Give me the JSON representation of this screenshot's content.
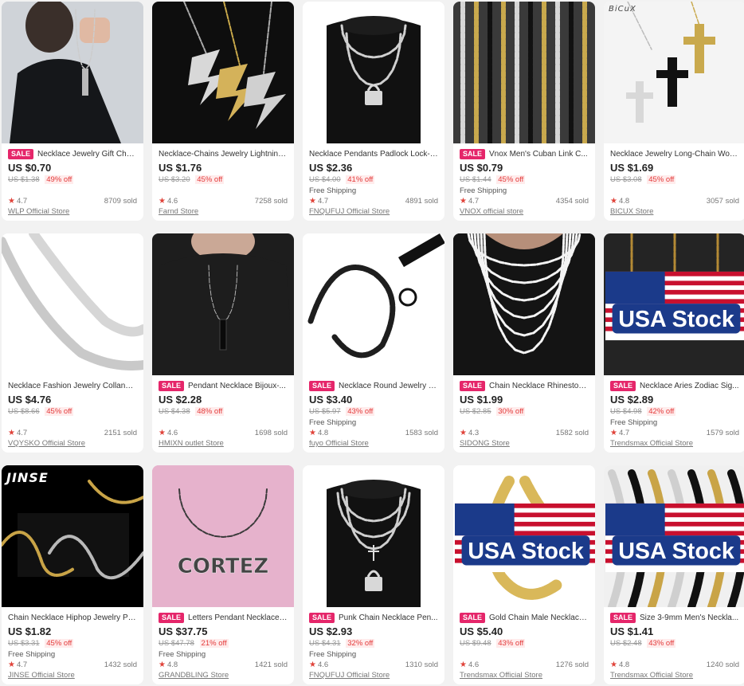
{
  "colors": {
    "sale_badge": "#e5266a",
    "discount": "#e33a3a",
    "star": "#e0433a",
    "background": "#f2f2f2"
  },
  "products": [
    {
      "sale": true,
      "title": "Necklace Jewelry Gift Chai...",
      "price": "US $0.70",
      "old_price": "US $1.38",
      "discount": "49% off",
      "shipping": "",
      "rating": "4.7",
      "sold": "8709 sold",
      "store": "WLP Official Store",
      "image": "man-with-pendant",
      "overlay": ""
    },
    {
      "sale": false,
      "title": "Necklace-Chains Jewelry Lightning ...",
      "price": "US $1.76",
      "old_price": "US $3.20",
      "discount": "45% off",
      "shipping": "",
      "rating": "4.6",
      "sold": "7258 sold",
      "store": "Farnd Store",
      "image": "lightning-pendants",
      "overlay": ""
    },
    {
      "sale": false,
      "title": "Necklace Pendants Padlock Lock-C...",
      "price": "US $2.36",
      "old_price": "US $4.00",
      "discount": "41% off",
      "shipping": "Free Shipping",
      "rating": "4.7",
      "sold": "4891 sold",
      "store": "FNQUFUJ Official Store",
      "image": "padlock-bust",
      "overlay": ""
    },
    {
      "sale": true,
      "title": "Vnox Men's Cuban Link C...",
      "price": "US $0.79",
      "old_price": "US $1.44",
      "discount": "45% off",
      "shipping": "Free Shipping",
      "rating": "4.7",
      "sold": "4354 sold",
      "store": "VNOX official store",
      "image": "cuban-chains",
      "overlay": ""
    },
    {
      "sale": false,
      "title": "Necklace Jewelry Long-Chain Wom...",
      "price": "US $1.69",
      "old_price": "US $3.08",
      "discount": "45% off",
      "shipping": "",
      "rating": "4.8",
      "sold": "3057 sold",
      "store": "BICUX Store",
      "image": "cross-pendants",
      "overlay": "BiCuX"
    },
    {
      "sale": false,
      "title": "Necklace Fashion Jewelry Collana ...",
      "price": "US $4.76",
      "old_price": "US $8.66",
      "discount": "45% off",
      "shipping": "",
      "rating": "4.7",
      "sold": "2151 sold",
      "store": "VQYSKO Official Store",
      "image": "silver-curb",
      "overlay": ""
    },
    {
      "sale": true,
      "title": "Pendant Necklace Bijoux-...",
      "price": "US $2.28",
      "old_price": "US $4.38",
      "discount": "48% off",
      "shipping": "",
      "rating": "4.6",
      "sold": "1698 sold",
      "store": "HMIXN outlet Store",
      "image": "bar-pendant",
      "overlay": ""
    },
    {
      "sale": true,
      "title": "Necklace Round Jewelry Li...",
      "price": "US $3.40",
      "old_price": "US $5.97",
      "discount": "43% off",
      "shipping": "Free Shipping",
      "rating": "4.8",
      "sold": "1583 sold",
      "store": "fuyo Official Store",
      "image": "leash-chain",
      "overlay": ""
    },
    {
      "sale": true,
      "title": "Chain Necklace Rhineston...",
      "price": "US $1.99",
      "old_price": "US $2.85",
      "discount": "30% off",
      "shipping": "",
      "rating": "4.3",
      "sold": "1582 sold",
      "store": "SIDONG Store",
      "image": "tennis-chains",
      "overlay": ""
    },
    {
      "sale": true,
      "title": "Necklace Aries Zodiac Sig...",
      "price": "US $2.89",
      "old_price": "US $4.98",
      "discount": "42% off",
      "shipping": "Free Shipping",
      "rating": "4.7",
      "sold": "1579 sold",
      "store": "Trendsmax Official Store",
      "image": "zodiac-medallions",
      "overlay": "USA Stock"
    },
    {
      "sale": false,
      "title": "Chain Necklace Hiphop Jewelry Pu...",
      "price": "US $1.82",
      "old_price": "US $3.31",
      "discount": "45% off",
      "shipping": "Free Shipping",
      "rating": "4.7",
      "sold": "1432 sold",
      "store": "JINSE Official Store",
      "image": "rope-chains",
      "overlay": "JINSE"
    },
    {
      "sale": true,
      "title": "Letters Pendant Necklace-...",
      "price": "US $37.75",
      "old_price": "US $47.78",
      "discount": "21% off",
      "shipping": "Free Shipping",
      "rating": "4.8",
      "sold": "1421 sold",
      "store": "GRANDBLING Store",
      "image": "name-letters",
      "overlay": "CORTEZ"
    },
    {
      "sale": true,
      "title": "Punk Chain Necklace Pen...",
      "price": "US $2.93",
      "old_price": "US $4.31",
      "discount": "32% off",
      "shipping": "Free Shipping",
      "rating": "4.6",
      "sold": "1310 sold",
      "store": "FNQUFUJ Official Store",
      "image": "punk-bust",
      "overlay": ""
    },
    {
      "sale": true,
      "title": "Gold Chain Male Necklace...",
      "price": "US $5.40",
      "old_price": "US $9.48",
      "discount": "43% off",
      "shipping": "",
      "rating": "4.6",
      "sold": "1276 sold",
      "store": "Trendsmax Official Store",
      "image": "gold-cuban",
      "overlay": "USA Stock"
    },
    {
      "sale": true,
      "title": "Size 3-9mm Men's Neckla...",
      "price": "US $1.41",
      "old_price": "US $2.48",
      "discount": "43% off",
      "shipping": "",
      "rating": "4.8",
      "sold": "1240 sold",
      "store": "Trendsmax Official Store",
      "image": "mixed-cuban",
      "overlay": "USA Stock"
    }
  ]
}
